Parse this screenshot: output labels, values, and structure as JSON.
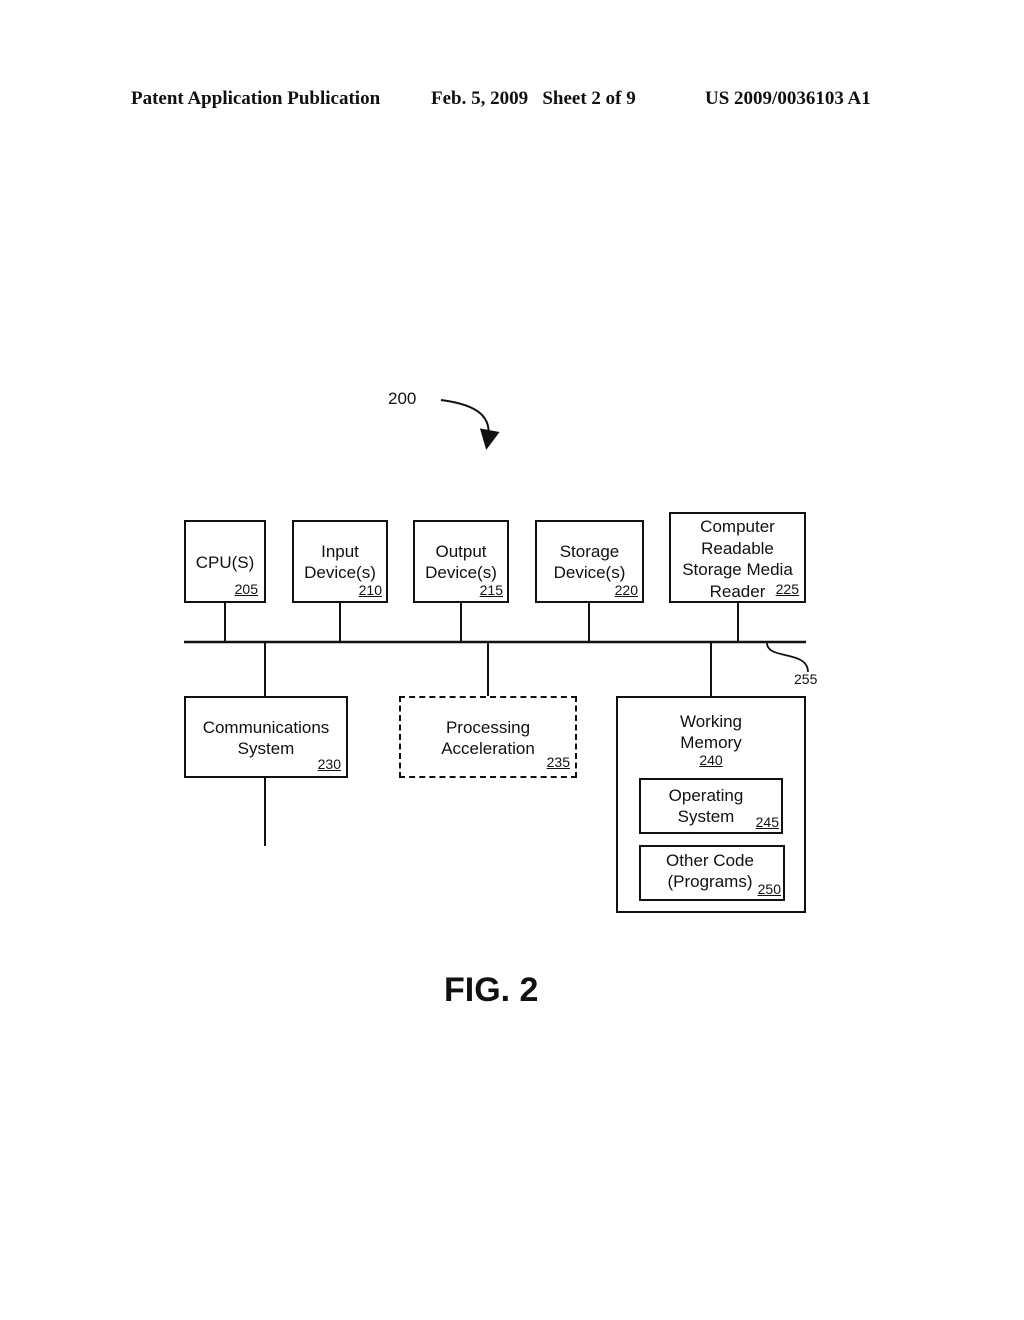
{
  "header": {
    "publication": "Patent Application Publication",
    "date_sheet": "Feb. 5, 2009   Sheet 2 of 9",
    "patent_number": "US 2009/0036103 A1"
  },
  "diagram": {
    "system_ref": "200",
    "bus_ref": "255",
    "top_components": [
      {
        "label": "CPU(S)",
        "ref": "205"
      },
      {
        "label": "Input\nDevice(s)",
        "ref": "210"
      },
      {
        "label": "Output\nDevice(s)",
        "ref": "215"
      },
      {
        "label": "Storage\nDevice(s)",
        "ref": "220"
      },
      {
        "label": "Computer\nReadable\nStorage Media\nReader",
        "ref": "225"
      }
    ],
    "bottom_components": [
      {
        "label": "Communications\nSystem",
        "ref": "230",
        "style": "solid"
      },
      {
        "label": "Processing\nAcceleration",
        "ref": "235",
        "style": "dashed"
      }
    ],
    "working_memory": {
      "label": "Working\nMemory",
      "ref": "240",
      "children": [
        {
          "label": "Operating\nSystem",
          "ref": "245"
        },
        {
          "label": "Other Code\n(Programs)",
          "ref": "250"
        }
      ]
    },
    "figure_label": "FIG. 2"
  }
}
